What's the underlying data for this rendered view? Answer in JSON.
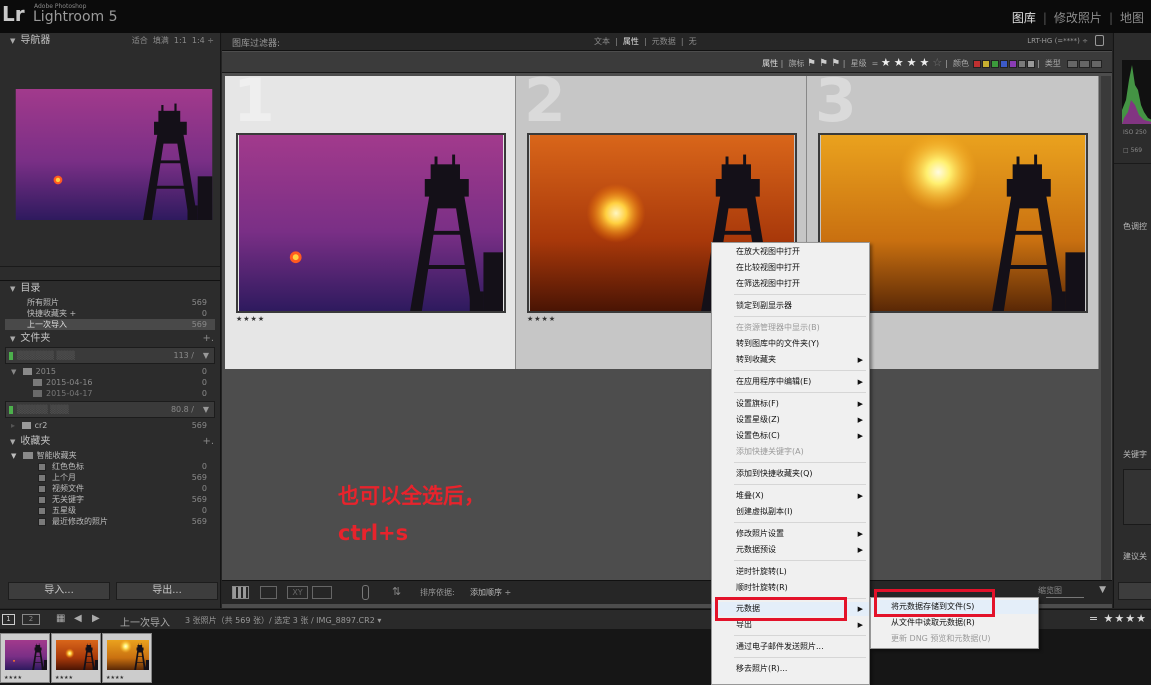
{
  "app": {
    "logo": "Lr",
    "vendor": "Adobe Photoshop",
    "name": "Lightroom 5"
  },
  "modules": [
    "图库",
    "修改照片",
    "地图"
  ],
  "navigator": {
    "title": "导航器",
    "zoom": [
      "适合",
      "填满",
      "1:1",
      "1:4"
    ]
  },
  "catalog": {
    "title": "目录",
    "items": [
      {
        "label": "所有照片",
        "count": "569"
      },
      {
        "label": "快捷收藏夹 +",
        "count": "0"
      },
      {
        "label": "上一次导入",
        "count": "569"
      }
    ]
  },
  "folders": {
    "title": "文件夹",
    "vol1_count": "113 /",
    "rows": [
      {
        "label": "2015",
        "count": "0"
      },
      {
        "label": "2015-04-16",
        "count": "0"
      },
      {
        "label": "2015-04-17",
        "count": "0"
      }
    ],
    "vol2_count": "80.8 /",
    "cr2": {
      "label": "cr2",
      "count": "569"
    }
  },
  "collections": {
    "title": "收藏夹",
    "smart": "智能收藏夹",
    "items": [
      {
        "label": "红色色标",
        "count": "0"
      },
      {
        "label": "上个月",
        "count": "569"
      },
      {
        "label": "视频文件",
        "count": "0"
      },
      {
        "label": "无关键字",
        "count": "569"
      },
      {
        "label": "五星级",
        "count": "0"
      },
      {
        "label": "最近修改的照片",
        "count": "569"
      }
    ]
  },
  "buttons": {
    "import": "导入...",
    "export": "导出..."
  },
  "filter_bar": {
    "title": "图库过滤器:",
    "tabs": [
      "文本",
      "属性",
      "元数据",
      "无"
    ],
    "preset": "LRT-HG (=****) ÷"
  },
  "attr_bar": {
    "attr": "属性",
    "flag": "旗标",
    "rating": "星级",
    "color": "颜色",
    "kind": "类型",
    "eq": "="
  },
  "label_colors": [
    "#c03030",
    "#c8b030",
    "#3c9a3c",
    "#3c5ac8",
    "#8a3cb4",
    "#7a7a7a"
  ],
  "grid": [
    {
      "num": "1",
      "stars": "★★★★"
    },
    {
      "num": "2",
      "stars": "★★★★"
    },
    {
      "num": "3",
      "stars": ""
    }
  ],
  "toolbar": {
    "sort_label": "排序依据:",
    "sort_value": "添加顺序 ÷",
    "thumb_label": "缩览图"
  },
  "filmstrip": {
    "pages": [
      "1",
      "2"
    ],
    "source": "上一次导入",
    "info": "3 张照片（共 569 张）/ 选定 3 张 / IMG_8897.CR2 ▾",
    "stars": "★★★★"
  },
  "right_panel": {
    "iso": "ISO 250",
    "tone": "色调控",
    "keyword": "关键字",
    "suggest": "建议关",
    "count": "569"
  },
  "context_menu": [
    {
      "label": "在放大视图中打开"
    },
    {
      "label": "在比较视图中打开"
    },
    {
      "label": "在筛选视图中打开"
    },
    {
      "label": "锁定到副显示器"
    },
    {
      "label": "在资源管理器中显示(B)",
      "disabled": true
    },
    {
      "label": "转到图库中的文件夹(Y)"
    },
    {
      "label": "转到收藏夹",
      "submenu": true
    },
    {
      "label": "在应用程序中编辑(E)",
      "submenu": true
    },
    {
      "label": "设置旗标(F)",
      "submenu": true
    },
    {
      "label": "设置星级(Z)",
      "submenu": true
    },
    {
      "label": "设置色标(C)",
      "submenu": true
    },
    {
      "label": "添加快捷关键字(A)",
      "disabled": true
    },
    {
      "label": "添加到快捷收藏夹(Q)"
    },
    {
      "label": "堆叠(X)",
      "submenu": true
    },
    {
      "label": "创建虚拟副本(I)"
    },
    {
      "label": "修改照片设置",
      "submenu": true
    },
    {
      "label": "元数据预设",
      "submenu": true
    },
    {
      "label": "逆时针旋转(L)"
    },
    {
      "label": "顺时针旋转(R)"
    },
    {
      "label": "元数据",
      "submenu": true
    },
    {
      "label": "导出",
      "submenu": true
    },
    {
      "label": "通过电子邮件发送照片..."
    },
    {
      "label": "移去照片(R)..."
    }
  ],
  "submenu": [
    {
      "label": "将元数据存储到文件(S)"
    },
    {
      "label": "从文件中读取元数据(R)"
    },
    {
      "label": "更新 DNG 预览和元数据(U)",
      "disabled": true
    }
  ],
  "annotation": {
    "line1": "也可以全选后，",
    "line2": "ctrl+s"
  }
}
